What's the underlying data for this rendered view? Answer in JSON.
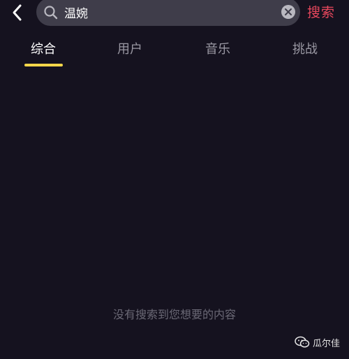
{
  "header": {
    "back_icon": "chevron-left-icon",
    "search": {
      "value": "温婉",
      "icon": "search-icon",
      "clear_icon": "close-circle-icon"
    },
    "submit_label": "搜索"
  },
  "tabs": [
    {
      "label": "综合",
      "active": true
    },
    {
      "label": "用户",
      "active": false
    },
    {
      "label": "音乐",
      "active": false
    },
    {
      "label": "挑战",
      "active": false
    }
  ],
  "empty_message": "没有搜索到您想要的内容",
  "watermark": {
    "text": "瓜尔佳",
    "icon": "wechat-icon"
  },
  "colors": {
    "background": "#15121f",
    "search_box": "#3f3d4a",
    "accent_submit": "#e8475d",
    "tab_indicator": "#f4d64a",
    "inactive_tab": "#9a98a3"
  }
}
